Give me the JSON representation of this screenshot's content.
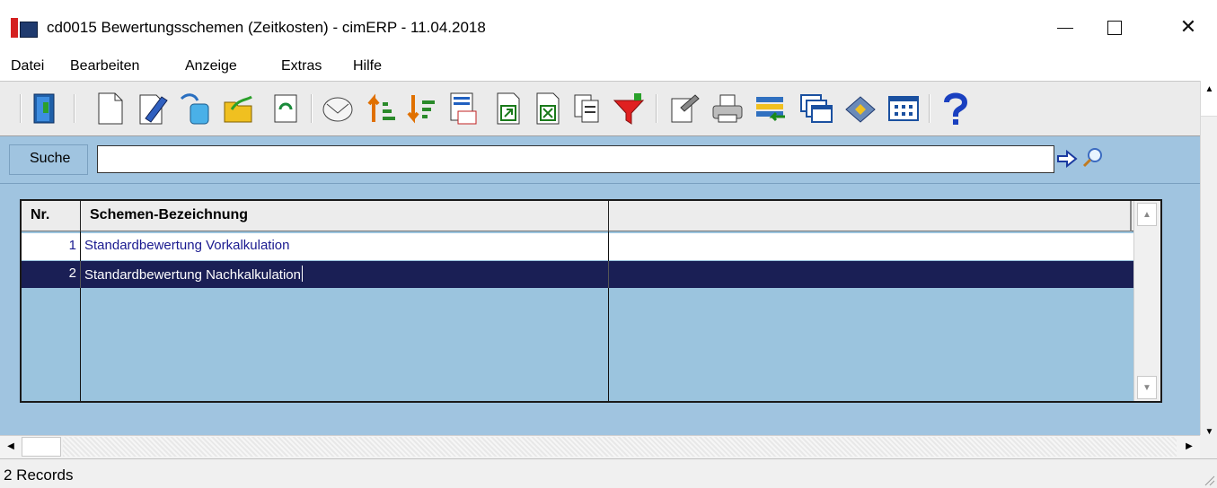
{
  "window": {
    "title": "cd0015 Bewertungsschemen (Zeitkosten) - cimERP - 11.04.2018",
    "minimize": "minimize",
    "maximize": "maximize",
    "close": "✕"
  },
  "menu": [
    "Datei",
    "Bearbeiten",
    "Anzeige",
    "Extras",
    "Hilfe"
  ],
  "toolbar": {
    "icons": [
      "exit-door-icon",
      "new-document-icon",
      "edit-pencil-icon",
      "copy-record-icon",
      "open-folder-icon",
      "refresh-icon",
      "email-icon",
      "sort-ascending-icon",
      "sort-descending-icon",
      "count-records-icon",
      "export-icon",
      "excel-export-icon",
      "duplicate-icon",
      "filter-icon",
      "properties-icon",
      "print-icon",
      "import-icon",
      "windows-icon",
      "notes-icon",
      "calendar-grid-icon",
      "help-icon"
    ]
  },
  "search": {
    "label": "Suche",
    "value": ""
  },
  "grid": {
    "columns": [
      "Nr.",
      "Schemen-Bezeichnung",
      ""
    ],
    "rows": [
      {
        "nr": "1",
        "bezeichnung": "Standardbewertung Vorkalkulation",
        "extra": ""
      },
      {
        "nr": "2",
        "bezeichnung": "Standardbewertung Nachkalkulation",
        "extra": ""
      }
    ],
    "selected_row": 2
  },
  "status": {
    "records": "2 Records"
  },
  "colors": {
    "panel": "#a0c4e0",
    "selection": "#1a1f55",
    "row_text": "#1a1a90"
  }
}
